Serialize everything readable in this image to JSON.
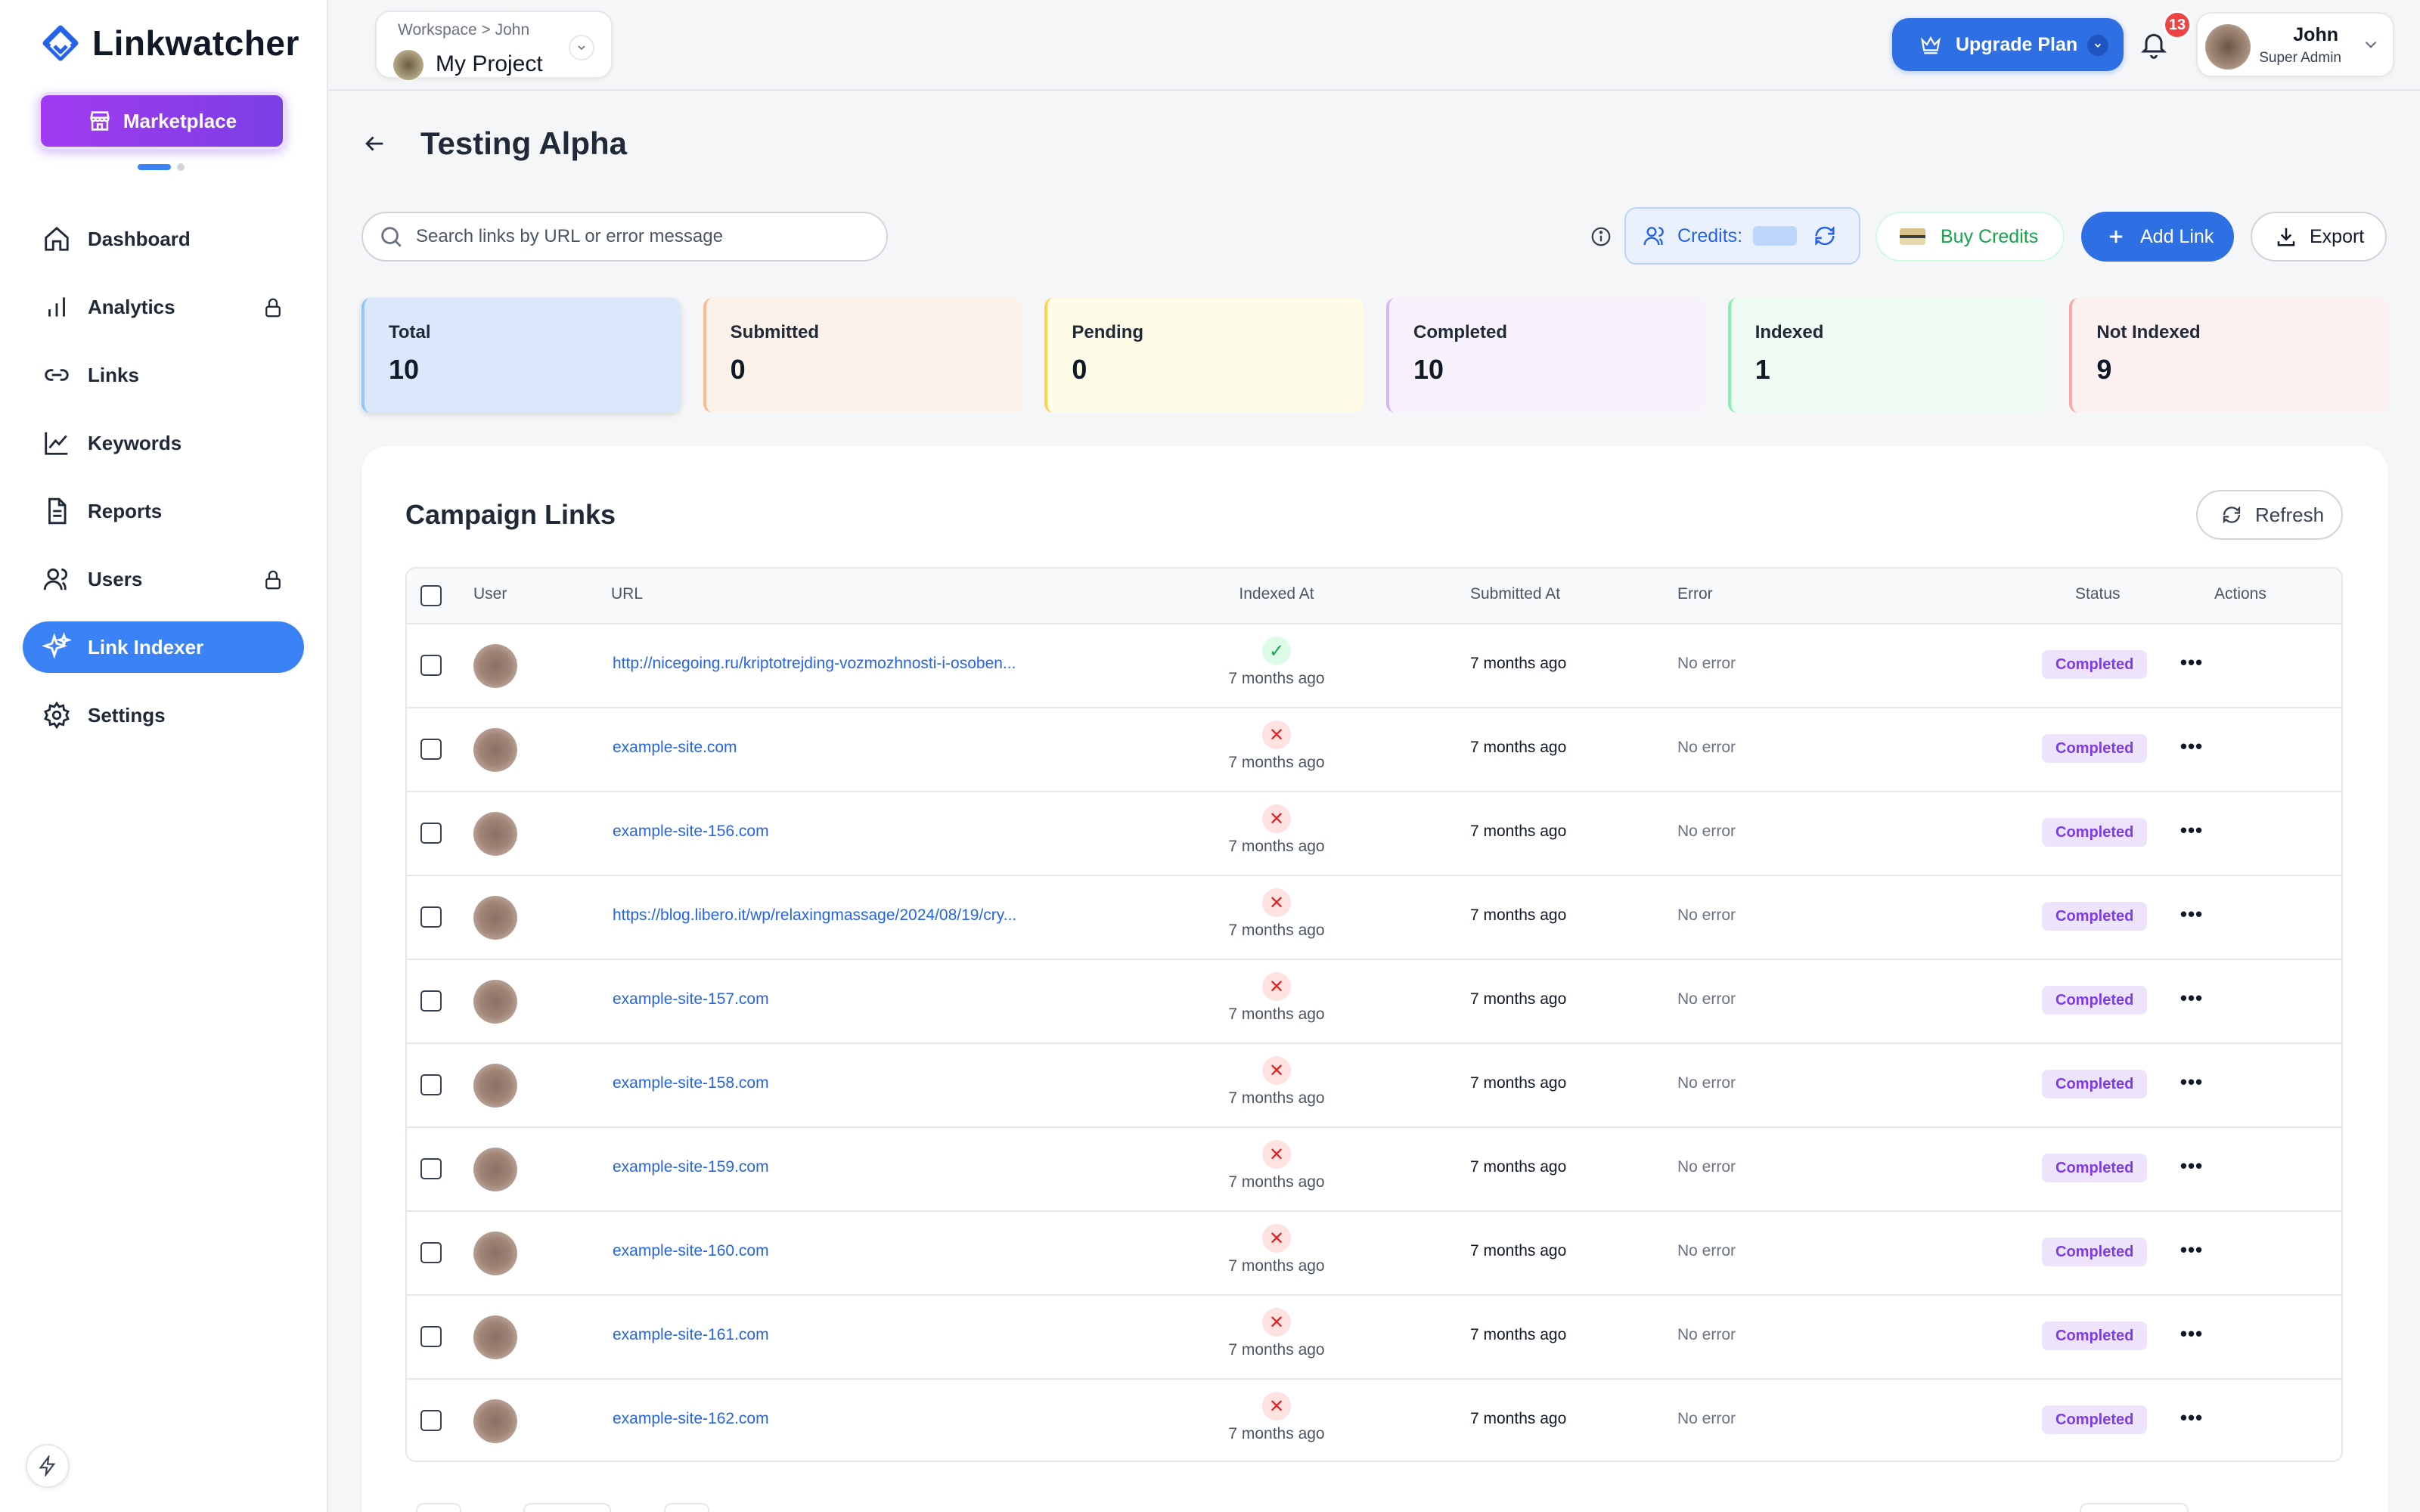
{
  "app": {
    "name": "Linkwatcher"
  },
  "sidebar": {
    "marketplace_label": "Marketplace",
    "items": [
      {
        "label": "Dashboard",
        "icon": "home-icon",
        "locked": false,
        "active": false
      },
      {
        "label": "Analytics",
        "icon": "bar-chart-icon",
        "locked": true,
        "active": false
      },
      {
        "label": "Links",
        "icon": "link-icon",
        "locked": false,
        "active": false
      },
      {
        "label": "Keywords",
        "icon": "line-chart-icon",
        "locked": false,
        "active": false
      },
      {
        "label": "Reports",
        "icon": "document-icon",
        "locked": false,
        "active": false
      },
      {
        "label": "Users",
        "icon": "users-icon",
        "locked": true,
        "active": false
      },
      {
        "label": "Link Indexer",
        "icon": "sparkle-icon",
        "locked": false,
        "active": true
      },
      {
        "label": "Settings",
        "icon": "gear-icon",
        "locked": false,
        "active": false
      }
    ]
  },
  "topbar": {
    "breadcrumb": "Workspace > John",
    "project_name": "My Project",
    "upgrade_label": "Upgrade Plan",
    "notification_count": "13",
    "user_name": "John",
    "user_role": "Super Admin"
  },
  "page": {
    "title": "Testing Alpha",
    "search_placeholder": "Search links by URL or error message",
    "credits_label": "Credits:",
    "buy_credits_label": "Buy Credits",
    "add_link_label": "Add Link",
    "export_label": "Export"
  },
  "stats": [
    {
      "label": "Total",
      "value": "10"
    },
    {
      "label": "Submitted",
      "value": "0"
    },
    {
      "label": "Pending",
      "value": "0"
    },
    {
      "label": "Completed",
      "value": "10"
    },
    {
      "label": "Indexed",
      "value": "1"
    },
    {
      "label": "Not Indexed",
      "value": "9"
    }
  ],
  "table": {
    "title": "Campaign Links",
    "refresh_label": "Refresh",
    "columns": [
      "User",
      "URL",
      "Indexed At",
      "Submitted At",
      "Error",
      "Status",
      "Actions"
    ],
    "rows": [
      {
        "url": "http://nicegoing.ru/kriptotrejding-vozmozhnosti-i-osoben...",
        "indexed": true,
        "indexed_at": "7 months ago",
        "submitted_at": "7 months ago",
        "error": "No error",
        "status": "Completed"
      },
      {
        "url": "example-site.com",
        "indexed": false,
        "indexed_at": "7 months ago",
        "submitted_at": "7 months ago",
        "error": "No error",
        "status": "Completed"
      },
      {
        "url": "example-site-156.com",
        "indexed": false,
        "indexed_at": "7 months ago",
        "submitted_at": "7 months ago",
        "error": "No error",
        "status": "Completed"
      },
      {
        "url": "https://blog.libero.it/wp/relaxingmassage/2024/08/19/cry...",
        "indexed": false,
        "indexed_at": "7 months ago",
        "submitted_at": "7 months ago",
        "error": "No error",
        "status": "Completed"
      },
      {
        "url": "example-site-157.com",
        "indexed": false,
        "indexed_at": "7 months ago",
        "submitted_at": "7 months ago",
        "error": "No error",
        "status": "Completed"
      },
      {
        "url": "example-site-158.com",
        "indexed": false,
        "indexed_at": "7 months ago",
        "submitted_at": "7 months ago",
        "error": "No error",
        "status": "Completed"
      },
      {
        "url": "example-site-159.com",
        "indexed": false,
        "indexed_at": "7 months ago",
        "submitted_at": "7 months ago",
        "error": "No error",
        "status": "Completed"
      },
      {
        "url": "example-site-160.com",
        "indexed": false,
        "indexed_at": "7 months ago",
        "submitted_at": "7 months ago",
        "error": "No error",
        "status": "Completed"
      },
      {
        "url": "example-site-161.com",
        "indexed": false,
        "indexed_at": "7 months ago",
        "submitted_at": "7 months ago",
        "error": "No error",
        "status": "Completed"
      },
      {
        "url": "example-site-162.com",
        "indexed": false,
        "indexed_at": "7 months ago",
        "submitted_at": "7 months ago",
        "error": "No error",
        "status": "Completed"
      }
    ]
  },
  "colors": {
    "accent": "#3b82f6",
    "brand_purple": "#7b3fe4",
    "success": "#16a34a",
    "danger": "#dc2626"
  }
}
